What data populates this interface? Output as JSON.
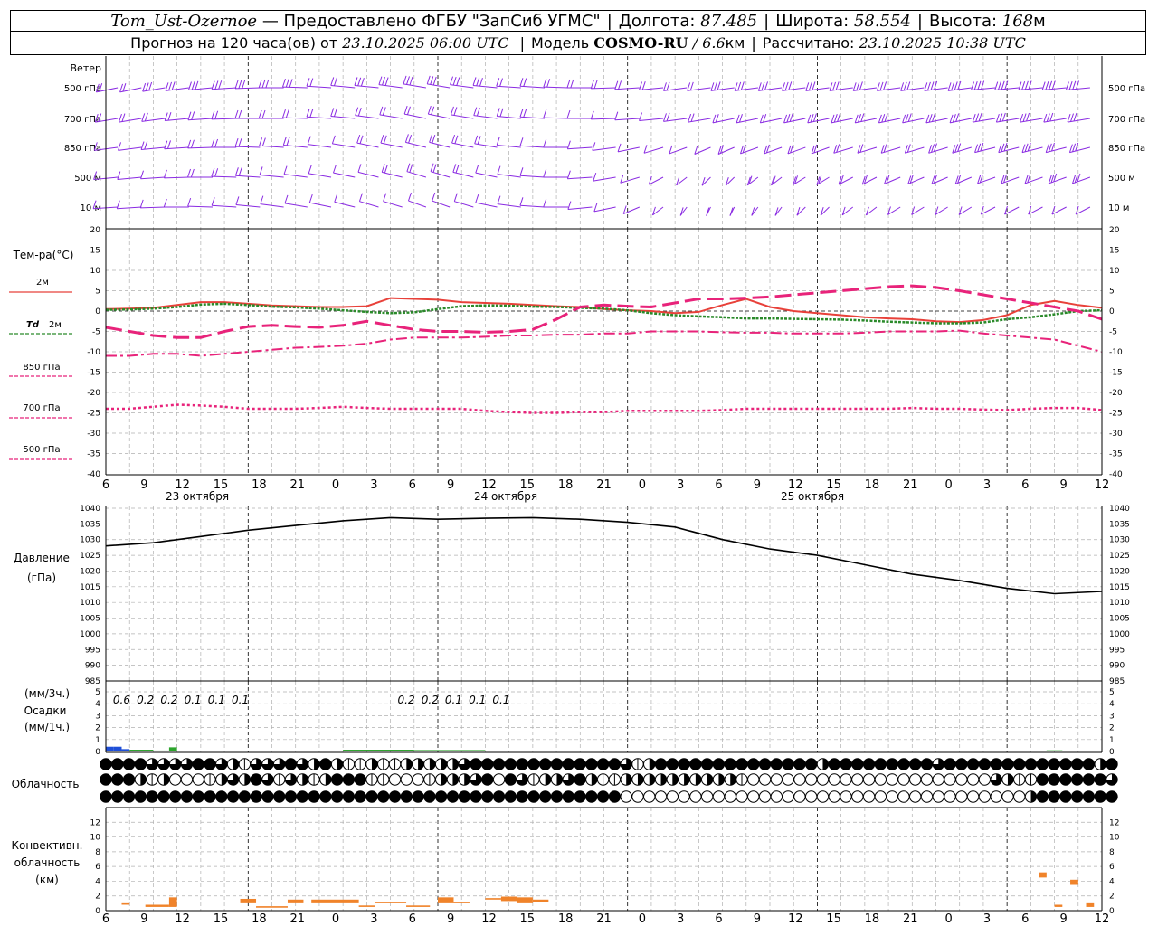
{
  "header": {
    "station": "Tom_Ust-Ozernoe",
    "provider": "— Предоставлено ФГБУ \"ЗапСиб УГМС\"",
    "lon_label": "Долгота:",
    "lon_value": "87.485",
    "lat_label": "Широта:",
    "lat_value": "58.554",
    "alt_label": "Высота:",
    "alt_value": "168",
    "alt_unit": "м",
    "forecast_prefix": "Прогноз на 120 часа(ов) от",
    "forecast_time": "23.10.2025 06:00 UTC",
    "model_label": "Модель",
    "model_name": "COSMO-RU",
    "model_res": "/ 6.6",
    "model_res_unit": "км",
    "calc_label": "Рассчитано:",
    "calc_time": "23.10.2025 10:38 UTC"
  },
  "labels": {
    "wind_title": "Ветер",
    "wind_levels": [
      "500 гПа",
      "700 гПа",
      "850 гПа",
      "500 м",
      "10  м"
    ],
    "temp_title": "Тем-ра(°С)",
    "t2m": "2м",
    "td_a": "Td",
    "td_b": "2м",
    "l850": "850 гПа",
    "l700": "700 гПа",
    "l500": "500 гПа",
    "pressure_a": "Давление",
    "pressure_b": "(гПа)",
    "precip_a": "(мм/3ч.)",
    "precip_b": "Осадки",
    "precip_c": "(мм/1ч.)",
    "cloud": "Облачность",
    "conv_a": "Конвективн.",
    "conv_b": "облачность",
    "conv_c": "(км)"
  },
  "time_axis": {
    "hour_labels": [
      "6",
      "9",
      "12",
      "15",
      "18",
      "21",
      "0",
      "3",
      "6",
      "9",
      "12",
      "15",
      "18",
      "21",
      "0",
      "3",
      "6",
      "9",
      "12",
      "15",
      "18",
      "21",
      "0",
      "3",
      "6",
      "9",
      "12"
    ],
    "day_labels": [
      "23 октября",
      "24 октября",
      "25 октября"
    ]
  },
  "colors": {
    "wind": "#8a2be2",
    "t2m": "#e8413a",
    "td": "#2a8a2a",
    "l850": "#e8237a",
    "l700": "#e8237a",
    "l500": "#e8237a",
    "pressure": "#000000",
    "precip_blue": "#1f4fd8",
    "precip_green": "#2ca52c",
    "convective": "#f0832a",
    "grid": "#b0b0b0"
  },
  "chart_data": [
    {
      "type": "line",
      "name": "temperature",
      "x_hours": [
        0,
        3,
        6,
        9,
        12,
        15,
        18,
        21,
        24,
        27,
        30,
        33,
        36,
        39,
        42,
        45,
        48,
        51,
        54,
        57,
        60,
        63,
        66,
        69,
        72,
        75,
        78,
        81,
        84,
        87,
        90,
        93,
        96,
        99,
        102,
        105,
        108,
        111,
        114,
        117,
        120,
        123,
        126
      ],
      "ylim": [
        -40,
        20
      ],
      "yticks": [
        20,
        15,
        10,
        5,
        0,
        -5,
        -10,
        -15,
        -20,
        -25,
        -30,
        -35,
        -40
      ],
      "series": [
        {
          "name": "2м",
          "values": [
            0.5,
            0.6,
            0.8,
            1.5,
            2.2,
            2.2,
            1.8,
            1.4,
            1.2,
            1.0,
            1.0,
            1.2,
            3.2,
            3.0,
            2.8,
            2.2,
            2.0,
            1.8,
            1.5,
            1.2,
            1.0,
            0.5,
            0.2,
            0.0,
            -0.5,
            -0.2,
            1.5,
            3.0,
            1.0,
            0.0,
            -0.5,
            -1.0,
            -1.5,
            -1.8,
            -2.0,
            -2.5,
            -2.7,
            -2.2,
            -1.0,
            1.5,
            2.5,
            1.5,
            0.8
          ]
        },
        {
          "name": "Td 2м",
          "values": [
            0.3,
            0.4,
            0.6,
            1.0,
            1.6,
            1.8,
            1.5,
            1.1,
            0.9,
            0.6,
            0.2,
            -0.2,
            -0.5,
            -0.3,
            0.5,
            1.2,
            1.4,
            1.3,
            1.1,
            1.0,
            0.8,
            0.6,
            0.2,
            -0.5,
            -1.0,
            -1.3,
            -1.5,
            -1.8,
            -1.8,
            -1.9,
            -2.0,
            -2.1,
            -2.3,
            -2.6,
            -2.8,
            -3.0,
            -3.0,
            -2.8,
            -2.0,
            -1.5,
            -0.8,
            0.0,
            0.2
          ]
        },
        {
          "name": "850 гПа",
          "values": [
            -4.0,
            -5.0,
            -6.0,
            -6.5,
            -6.5,
            -5.0,
            -3.8,
            -3.5,
            -3.8,
            -4.0,
            -3.5,
            -2.5,
            -3.5,
            -4.5,
            -5.0,
            -5.0,
            -5.2,
            -5.0,
            -4.5,
            -2.0,
            1.0,
            1.5,
            1.2,
            1.0,
            2.0,
            3.0,
            3.0,
            3.2,
            3.5,
            4.0,
            4.5,
            5.0,
            5.5,
            6.0,
            6.2,
            5.8,
            5.0,
            4.0,
            3.0,
            2.0,
            1.0,
            0.0,
            -2.0
          ]
        },
        {
          "name": "700 гПа",
          "values": [
            -11.0,
            -11.0,
            -10.5,
            -10.5,
            -11.0,
            -10.5,
            -10.0,
            -9.5,
            -9.0,
            -8.8,
            -8.5,
            -8.0,
            -7.0,
            -6.5,
            -6.5,
            -6.5,
            -6.3,
            -6.0,
            -6.0,
            -5.8,
            -5.8,
            -5.5,
            -5.5,
            -5.0,
            -5.0,
            -5.0,
            -5.2,
            -5.3,
            -5.3,
            -5.5,
            -5.5,
            -5.5,
            -5.3,
            -5.0,
            -5.0,
            -5.0,
            -4.8,
            -5.5,
            -6.0,
            -6.5,
            -7.0,
            -8.5,
            -10.0
          ]
        },
        {
          "name": "500 гПа",
          "values": [
            -24.0,
            -24.0,
            -23.5,
            -23.0,
            -23.2,
            -23.5,
            -24.0,
            -24.0,
            -24.0,
            -23.8,
            -23.5,
            -23.8,
            -24.0,
            -24.0,
            -24.0,
            -24.0,
            -24.5,
            -24.8,
            -25.0,
            -25.0,
            -24.8,
            -24.8,
            -24.5,
            -24.5,
            -24.5,
            -24.5,
            -24.3,
            -24.0,
            -24.0,
            -24.0,
            -24.0,
            -24.0,
            -24.0,
            -24.0,
            -23.8,
            -24.0,
            -24.0,
            -24.2,
            -24.3,
            -24.0,
            -23.8,
            -23.8,
            -24.3
          ]
        }
      ]
    },
    {
      "type": "line",
      "name": "pressure",
      "x_hours": [
        0,
        6,
        12,
        18,
        24,
        30,
        36,
        42,
        48,
        54,
        60,
        66,
        72,
        78,
        84,
        90,
        96,
        102,
        108,
        114,
        120,
        126
      ],
      "ylim": [
        985,
        1040
      ],
      "yticks": [
        1040,
        1035,
        1030,
        1025,
        1020,
        1015,
        1010,
        1005,
        1000,
        995,
        990,
        985
      ],
      "series": [
        {
          "name": "",
          "values": [
            1028,
            1029,
            1031,
            1033,
            1034.5,
            1036,
            1037,
            1036.5,
            1036.8,
            1037,
            1036.5,
            1035.5,
            1034,
            1030,
            1027,
            1025,
            1022,
            1019,
            1017,
            1014.5,
            1012.8,
            1013.5
          ]
        }
      ]
    },
    {
      "type": "bar",
      "name": "precipitation",
      "ylim": [
        0,
        5
      ],
      "yticks": [
        5,
        4,
        3,
        2,
        1,
        0
      ],
      "labels_3h": [
        {
          "hour": 2,
          "text": "0.6"
        },
        {
          "hour": 5,
          "text": "0.2"
        },
        {
          "hour": 8,
          "text": "0.2"
        },
        {
          "hour": 11,
          "text": "0.1"
        },
        {
          "hour": 14,
          "text": "0.1"
        },
        {
          "hour": 17,
          "text": "0.1"
        },
        {
          "hour": 38,
          "text": "0.2"
        },
        {
          "hour": 41,
          "text": "0.2"
        },
        {
          "hour": 44,
          "text": "0.1"
        },
        {
          "hour": 47,
          "text": "0.1"
        },
        {
          "hour": 50,
          "text": "0.1"
        }
      ],
      "bars": [
        {
          "h0": 0,
          "h1": 1,
          "v": 0.4,
          "c": "blue"
        },
        {
          "h0": 1,
          "h1": 2,
          "v": 0.4,
          "c": "blue"
        },
        {
          "h0": 2,
          "h1": 3,
          "v": 0.2,
          "c": "blue"
        },
        {
          "h0": 3,
          "h1": 6,
          "v": 0.15,
          "c": "green"
        },
        {
          "h0": 6,
          "h1": 8,
          "v": 0.08,
          "c": "green"
        },
        {
          "h0": 8,
          "h1": 9,
          "v": 0.35,
          "c": "green"
        },
        {
          "h0": 9,
          "h1": 18,
          "v": 0.05,
          "c": "green"
        },
        {
          "h0": 24,
          "h1": 30,
          "v": 0.05,
          "c": "green"
        },
        {
          "h0": 30,
          "h1": 39,
          "v": 0.15,
          "c": "green"
        },
        {
          "h0": 39,
          "h1": 48,
          "v": 0.12,
          "c": "green"
        },
        {
          "h0": 48,
          "h1": 57,
          "v": 0.06,
          "c": "green"
        },
        {
          "h0": 119,
          "h1": 121,
          "v": 0.1,
          "c": "green"
        }
      ]
    },
    {
      "type": "table",
      "name": "cloudiness",
      "levels": 3,
      "rows": [
        "4444333344321333432421121122222344444444444443124444444444444424444444443444444444444424",
        "4442120001232431321244411000122234043122342112222222222100000000000000000000032114444443",
        "4444444444444444444444444444444444444444444440000000000000000000000000000000000024444444"
      ]
    },
    {
      "type": "bar",
      "name": "convective_cloud",
      "ylim": [
        0,
        14
      ],
      "yticks": [
        12,
        10,
        8,
        6,
        4,
        2,
        0
      ],
      "bars": [
        {
          "h0": 2,
          "h1": 3,
          "v0": 0.8,
          "v1": 1.0
        },
        {
          "h0": 5,
          "h1": 8,
          "v0": 0.5,
          "v1": 0.8
        },
        {
          "h0": 8,
          "h1": 9,
          "v0": 0.5,
          "v1": 1.8
        },
        {
          "h0": 17,
          "h1": 19,
          "v0": 1.0,
          "v1": 1.6
        },
        {
          "h0": 19,
          "h1": 23,
          "v0": 0.4,
          "v1": 0.6
        },
        {
          "h0": 23,
          "h1": 25,
          "v0": 1.0,
          "v1": 1.5
        },
        {
          "h0": 26,
          "h1": 32,
          "v0": 1.0,
          "v1": 1.5
        },
        {
          "h0": 32,
          "h1": 34,
          "v0": 0.5,
          "v1": 0.7
        },
        {
          "h0": 34,
          "h1": 38,
          "v0": 1.0,
          "v1": 1.2
        },
        {
          "h0": 38,
          "h1": 41,
          "v0": 0.5,
          "v1": 0.7
        },
        {
          "h0": 42,
          "h1": 44,
          "v0": 1.0,
          "v1": 1.8
        },
        {
          "h0": 44,
          "h1": 46,
          "v0": 1.0,
          "v1": 1.2
        },
        {
          "h0": 48,
          "h1": 50,
          "v0": 1.5,
          "v1": 1.7
        },
        {
          "h0": 50,
          "h1": 52,
          "v0": 1.3,
          "v1": 1.9
        },
        {
          "h0": 52,
          "h1": 54,
          "v0": 1.0,
          "v1": 1.8
        },
        {
          "h0": 54,
          "h1": 56,
          "v0": 1.2,
          "v1": 1.5
        },
        {
          "h0": 118,
          "h1": 119,
          "v0": 4.5,
          "v1": 5.2
        },
        {
          "h0": 120,
          "h1": 121,
          "v0": 0.5,
          "v1": 0.8
        },
        {
          "h0": 122,
          "h1": 123,
          "v0": 3.5,
          "v1": 4.2
        },
        {
          "h0": 124,
          "h1": 125,
          "v0": 0.5,
          "v1": 1.0
        }
      ]
    },
    {
      "type": "scatter",
      "name": "wind_barbs",
      "levels": [
        "500 гПа",
        "700 гПа",
        "850 гПа",
        "500 м",
        "10  м"
      ],
      "dir_deg": [
        [
          240,
          240,
          245,
          250,
          255,
          260,
          265,
          270,
          275,
          280,
          285,
          285,
          290,
          295,
          295,
          290,
          285,
          280,
          280,
          275,
          270,
          265,
          260,
          255,
          250,
          250,
          250,
          250,
          250,
          250,
          250,
          250,
          250,
          250,
          250,
          250,
          250,
          255,
          255,
          255,
          255,
          255
        ],
        [
          245,
          245,
          250,
          255,
          260,
          265,
          270,
          270,
          275,
          280,
          285,
          290,
          295,
          300,
          300,
          295,
          290,
          285,
          280,
          275,
          270,
          265,
          260,
          255,
          250,
          245,
          240,
          240,
          240,
          240,
          240,
          240,
          240,
          240,
          240,
          240,
          240,
          245,
          245,
          245,
          245,
          245
        ],
        [
          250,
          250,
          255,
          260,
          265,
          270,
          275,
          280,
          285,
          290,
          295,
          300,
          300,
          305,
          305,
          300,
          295,
          285,
          280,
          270,
          260,
          250,
          240,
          230,
          225,
          220,
          220,
          225,
          225,
          225,
          225,
          230,
          230,
          230,
          230,
          230,
          230,
          235,
          235,
          235,
          235,
          235
        ],
        [
          255,
          255,
          260,
          265,
          270,
          275,
          280,
          285,
          290,
          295,
          300,
          305,
          305,
          310,
          310,
          305,
          300,
          290,
          280,
          270,
          260,
          245,
          230,
          215,
          205,
          200,
          200,
          205,
          205,
          210,
          210,
          215,
          215,
          220,
          220,
          220,
          220,
          225,
          225,
          225,
          225,
          225
        ],
        [
          260,
          260,
          265,
          270,
          275,
          280,
          285,
          290,
          295,
          300,
          305,
          310,
          310,
          315,
          315,
          310,
          300,
          290,
          280,
          270,
          255,
          240,
          220,
          205,
          195,
          190,
          190,
          195,
          195,
          200,
          200,
          205,
          205,
          210,
          210,
          210,
          210,
          215,
          215,
          215,
          215,
          215
        ]
      ],
      "speed_ms": [
        [
          12,
          12,
          13,
          13,
          14,
          14,
          14,
          13,
          13,
          12,
          12,
          13,
          14,
          15,
          15,
          14,
          13,
          12,
          11,
          10,
          9,
          9,
          9,
          10,
          11,
          12,
          13,
          14,
          15,
          16,
          16,
          16,
          17,
          17,
          17,
          18,
          18,
          18,
          19,
          19,
          20,
          20
        ],
        [
          9,
          9,
          10,
          10,
          11,
          11,
          11,
          10,
          10,
          9,
          9,
          10,
          11,
          12,
          12,
          11,
          10,
          9,
          8,
          7,
          6,
          6,
          6,
          7,
          8,
          9,
          10,
          11,
          12,
          13,
          13,
          13,
          14,
          14,
          14,
          15,
          15,
          15,
          16,
          16,
          17,
          17
        ],
        [
          7,
          7,
          8,
          8,
          9,
          9,
          9,
          8,
          8,
          7,
          7,
          8,
          9,
          10,
          10,
          9,
          8,
          7,
          6,
          5,
          4,
          4,
          4,
          5,
          6,
          7,
          8,
          9,
          10,
          11,
          11,
          11,
          12,
          12,
          12,
          13,
          13,
          13,
          14,
          14,
          15,
          15
        ],
        [
          6,
          6,
          7,
          7,
          8,
          8,
          8,
          7,
          7,
          6,
          6,
          7,
          8,
          9,
          9,
          8,
          7,
          6,
          5,
          4,
          3,
          3,
          3,
          4,
          5,
          6,
          7,
          8,
          9,
          9,
          9,
          10,
          10,
          10,
          11,
          11,
          11,
          12,
          12,
          12,
          13,
          13
        ],
        [
          3,
          3,
          4,
          4,
          4,
          4,
          4,
          3,
          3,
          3,
          3,
          4,
          4,
          5,
          5,
          4,
          3,
          3,
          2,
          2,
          2,
          2,
          2,
          2,
          3,
          3,
          3,
          4,
          4,
          4,
          4,
          5,
          5,
          5,
          5,
          6,
          6,
          6,
          6,
          6,
          7,
          7
        ]
      ]
    }
  ]
}
